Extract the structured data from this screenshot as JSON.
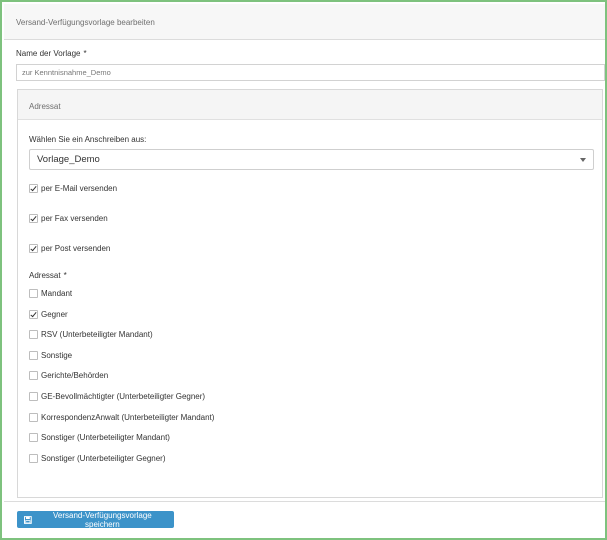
{
  "header": {
    "title": "Versand-Verfügungsvorlage bearbeiten"
  },
  "name_field": {
    "label": "Name der Vorlage",
    "required_marker": "*",
    "value": "zur Kenntnisnahme_Demo"
  },
  "adressat_panel": {
    "title": "Adressat",
    "select_label": "Wählen Sie ein Anschreiben aus:",
    "selected_value": "Vorlage_Demo",
    "send_options": [
      {
        "label": "per E-Mail versenden",
        "checked": true
      },
      {
        "label": "per Fax versenden",
        "checked": true
      },
      {
        "label": "per Post versenden",
        "checked": true
      }
    ],
    "adressat_label": "Adressat",
    "adressat_required_marker": "*",
    "recipients": [
      {
        "label": "Mandant",
        "checked": false
      },
      {
        "label": "Gegner",
        "checked": true
      },
      {
        "label": "RSV (Unterbeteiligter Mandant)",
        "checked": false
      },
      {
        "label": "Sonstige",
        "checked": false
      },
      {
        "label": "Gerichte/Behörden",
        "checked": false
      },
      {
        "label": "GE-Bevollmächtigter (Unterbeteiligter Gegner)",
        "checked": false
      },
      {
        "label": "KorrespondenzAnwalt (Unterbeteiligter Mandant)",
        "checked": false
      },
      {
        "label": "Sonstiger (Unterbeteiligter Mandant)",
        "checked": false
      },
      {
        "label": "Sonstiger (Unterbeteiligter Gegner)",
        "checked": false
      }
    ]
  },
  "footer": {
    "save_label": "Versand-Verfügungsvorlage speichern",
    "save_icon": "floppy-disk-icon"
  },
  "colors": {
    "frame_border": "#7ec27e",
    "button_bg": "#3c93c9"
  }
}
